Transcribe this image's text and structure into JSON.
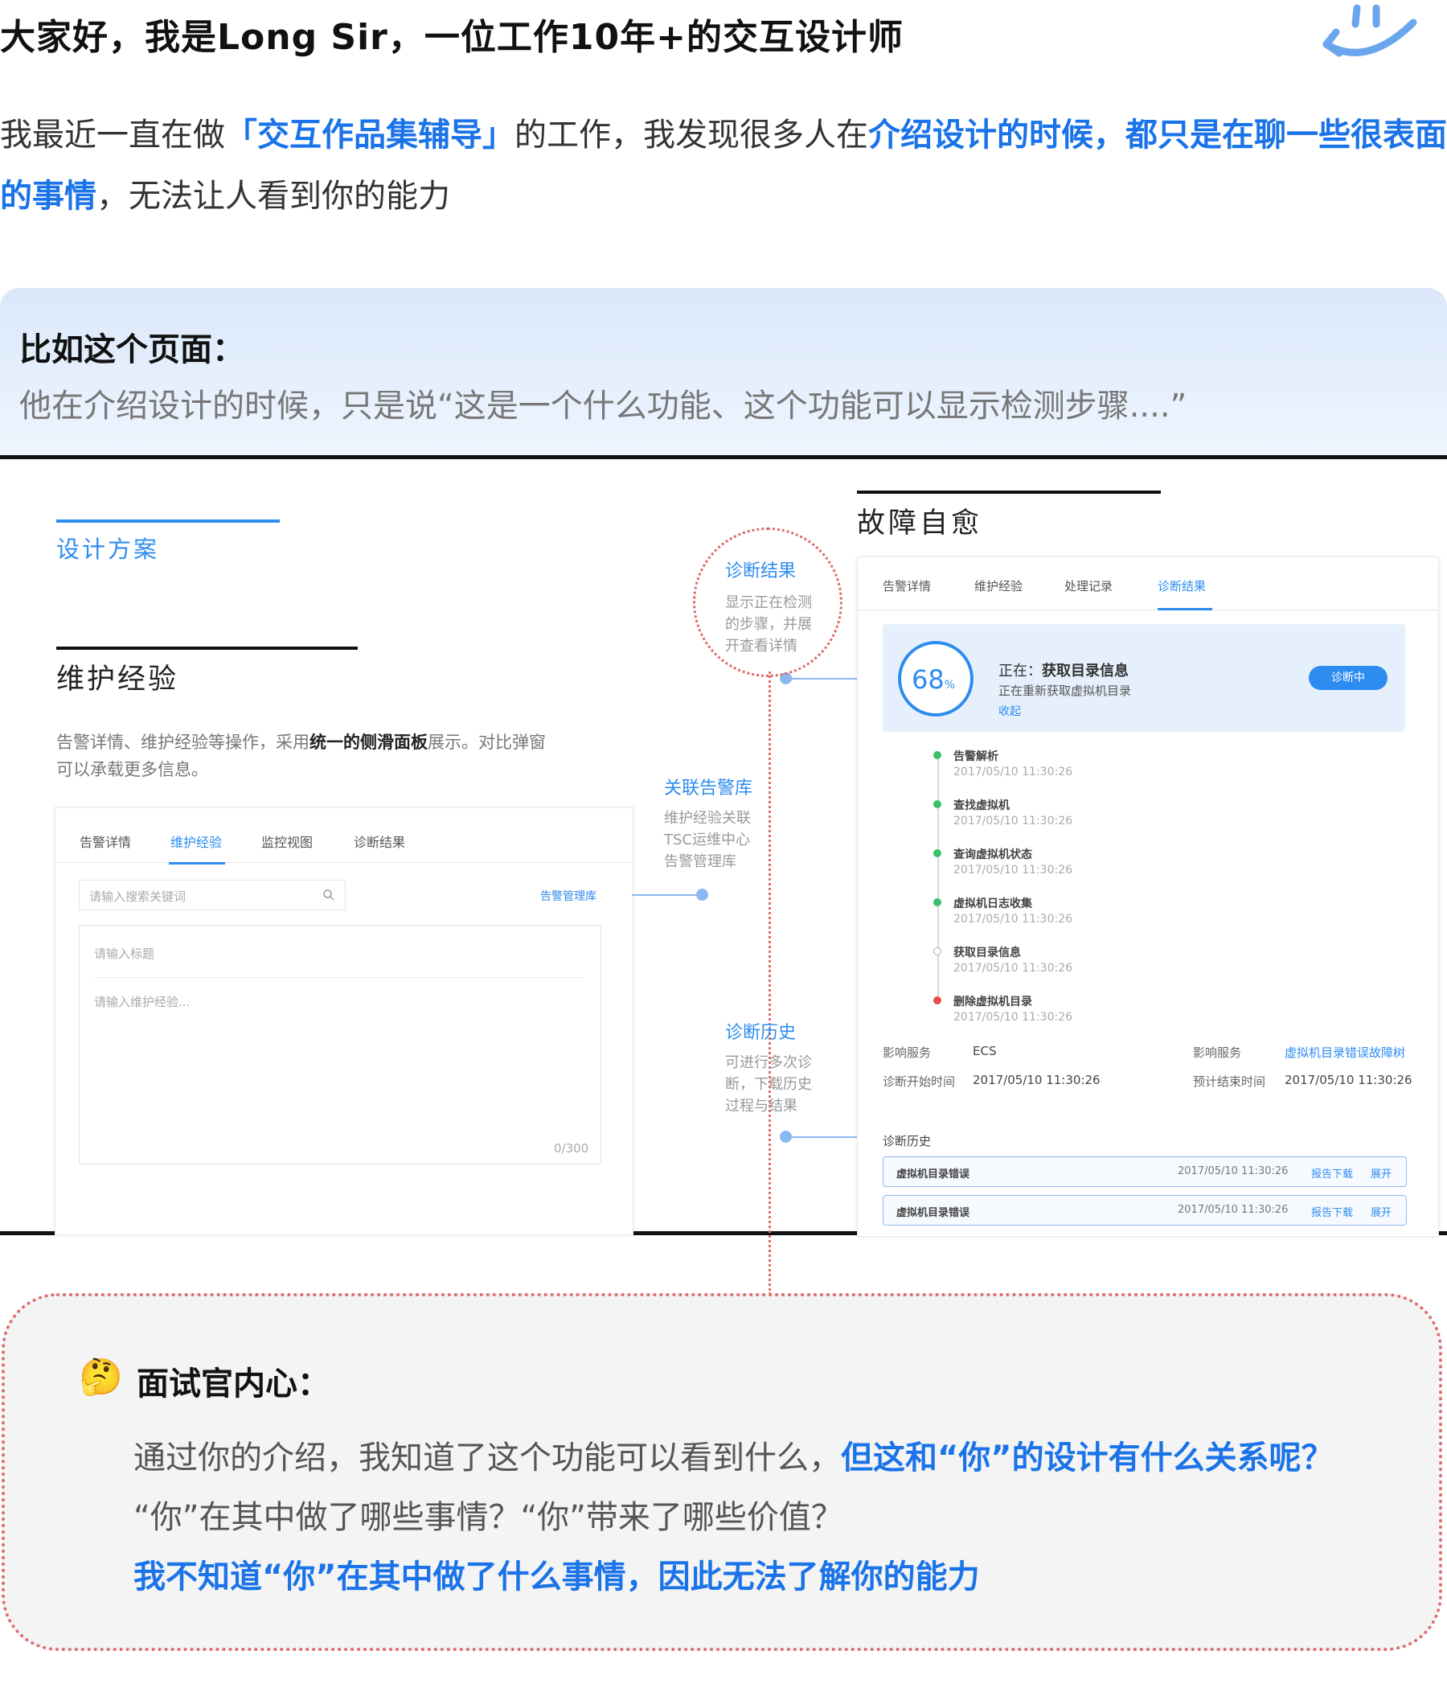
{
  "header": {
    "title": "大家好，我是Long Sir，一位工作10年+的交互设计师",
    "intro_prefix": "我最近一直在做",
    "intro_highlight1": "「交互作品集辅导」",
    "intro_mid": "的工作，我发现很多人在",
    "intro_highlight2": "介绍设计的时候，都只是在聊一些很表面的事情",
    "intro_suffix": "，无法让人看到你的能力"
  },
  "callout": {
    "title": "比如这个页面：",
    "body": "他在介绍设计的时候，只是说“这是一个什么功能、这个功能可以显示检测步骤....”"
  },
  "design": {
    "section_label": "设计方案",
    "maint_title": "维护经验",
    "maint_desc_1a": "告警详情、维护经验等操作，采用",
    "maint_desc_1b": "统一的侧滑面板",
    "maint_desc_1c": "展示。对比弹窗",
    "maint_desc_2": "可以承载更多信息。",
    "left_tabs": [
      "告警详情",
      "维护经验",
      "监控视图",
      "诊断结果"
    ],
    "search_placeholder": "请输入搜索关键词",
    "alarm_lib_link": "告警管理库",
    "title_placeholder": "请输入标题",
    "content_placeholder": "请输入维护经验...",
    "counter": "0/300",
    "ann1_title": "诊断结果",
    "ann1_lines": [
      "显示正在检测",
      "的步骤，并展",
      "开查看详情"
    ],
    "ann2_title": "关联告警库",
    "ann2_lines": [
      "维护经验关联",
      "TSC运维中心",
      "告警管理库"
    ],
    "ann3_title": "诊断历史",
    "ann3_lines": [
      "可进行多次诊",
      "断，下载历史",
      "过程与结果"
    ],
    "right_title": "故障自愈",
    "right_tabs": [
      "告警详情",
      "维护经验",
      "处理记录",
      "诊断结果"
    ],
    "progress_value": "68",
    "progress_unit": "%",
    "progress_percent": 68,
    "status_label": "正在：",
    "status_value": "获取目录信息",
    "status_sub": "正在重新获取虚拟机目录",
    "collapse": "收起",
    "diag_btn": "诊断中",
    "steps": [
      {
        "name": "告警解析",
        "time": "2017/05/10 11:30:26",
        "state": "done"
      },
      {
        "name": "查找虚拟机",
        "time": "2017/05/10 11:30:26",
        "state": "done"
      },
      {
        "name": "查询虚拟机状态",
        "time": "2017/05/10 11:30:26",
        "state": "done"
      },
      {
        "name": "虚拟机日志收集",
        "time": "2017/05/10 11:30:26",
        "state": "done"
      },
      {
        "name": "获取目录信息",
        "time": "2017/05/10 11:30:26",
        "state": "current"
      },
      {
        "name": "删除虚拟机目录",
        "time": "2017/05/10 11:30:26",
        "state": "error"
      }
    ],
    "info_k1": "影响服务",
    "info_v1": "ECS",
    "info_k2": "影响服务",
    "info_v2": "虚拟机目录错误故障树",
    "info_k3": "诊断开始时间",
    "info_v3": "2017/05/10 11:30:26",
    "info_k4": "预计结束时间",
    "info_v4": "2017/05/10 11:30:26",
    "history_title": "诊断历史",
    "history": [
      {
        "name": "虚拟机目录错误",
        "time": "2017/05/10 11:30:26",
        "dl": "报告下载",
        "ex": "展开"
      },
      {
        "name": "虚拟机目录错误",
        "time": "2017/05/10 11:30:26",
        "dl": "报告下载",
        "ex": "展开"
      }
    ]
  },
  "bottom": {
    "emoji": "🤔",
    "title": "面试官内心：",
    "line1_a": "通过你的介绍，我知道了这个功能可以看到什么，",
    "line1_b": "但这和“你”的设计有什么关系呢？",
    "line2": "“你”在其中做了哪些事情？“你”带来了哪些价值？",
    "line3": "我不知道“你”在其中做了什么事情，因此无法了解你的能力"
  },
  "colors": {
    "accent": "#1a73e8",
    "light_blue": "#2d8cf0",
    "red_dotted": "#e06a6a",
    "callout_bg": "#dbe8fa"
  }
}
